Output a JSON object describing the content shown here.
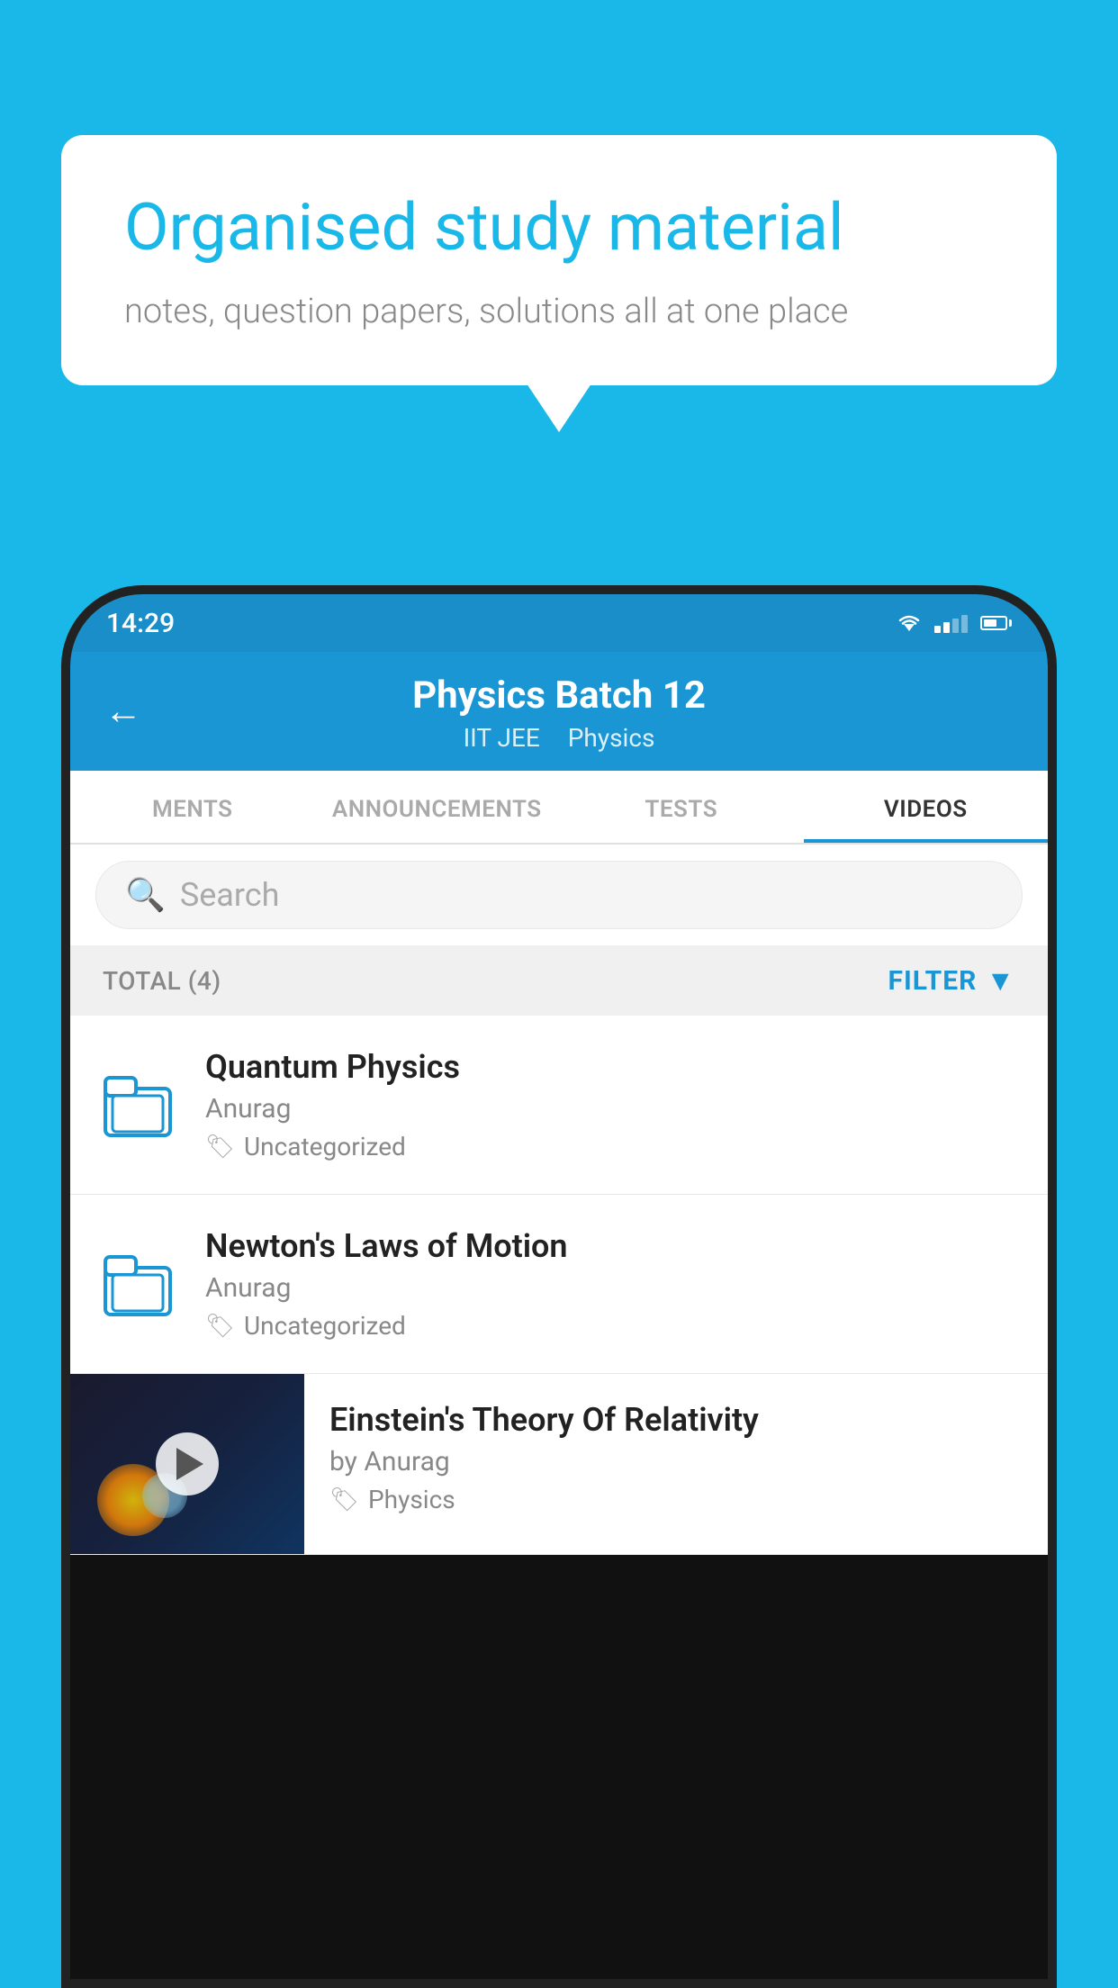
{
  "background_color": "#1ab8e8",
  "bubble": {
    "title": "Organised study material",
    "subtitle": "notes, question papers, solutions all at one place"
  },
  "phone": {
    "status_bar": {
      "time": "14:29"
    },
    "header": {
      "back_label": "←",
      "title": "Physics Batch 12",
      "tag1": "IIT JEE",
      "tag2": "Physics"
    },
    "tabs": [
      {
        "label": "MENTS",
        "active": false
      },
      {
        "label": "ANNOUNCEMENTS",
        "active": false
      },
      {
        "label": "TESTS",
        "active": false
      },
      {
        "label": "VIDEOS",
        "active": true
      }
    ],
    "search": {
      "placeholder": "Search"
    },
    "filter_bar": {
      "total_label": "TOTAL (4)",
      "filter_label": "FILTER"
    },
    "videos": [
      {
        "id": 1,
        "title": "Quantum Physics",
        "author": "Anurag",
        "tag": "Uncategorized",
        "has_thumb": false
      },
      {
        "id": 2,
        "title": "Newton's Laws of Motion",
        "author": "Anurag",
        "tag": "Uncategorized",
        "has_thumb": false
      },
      {
        "id": 3,
        "title": "Einstein's Theory Of Relativity",
        "author": "by Anurag",
        "tag": "Physics",
        "has_thumb": true
      }
    ]
  }
}
